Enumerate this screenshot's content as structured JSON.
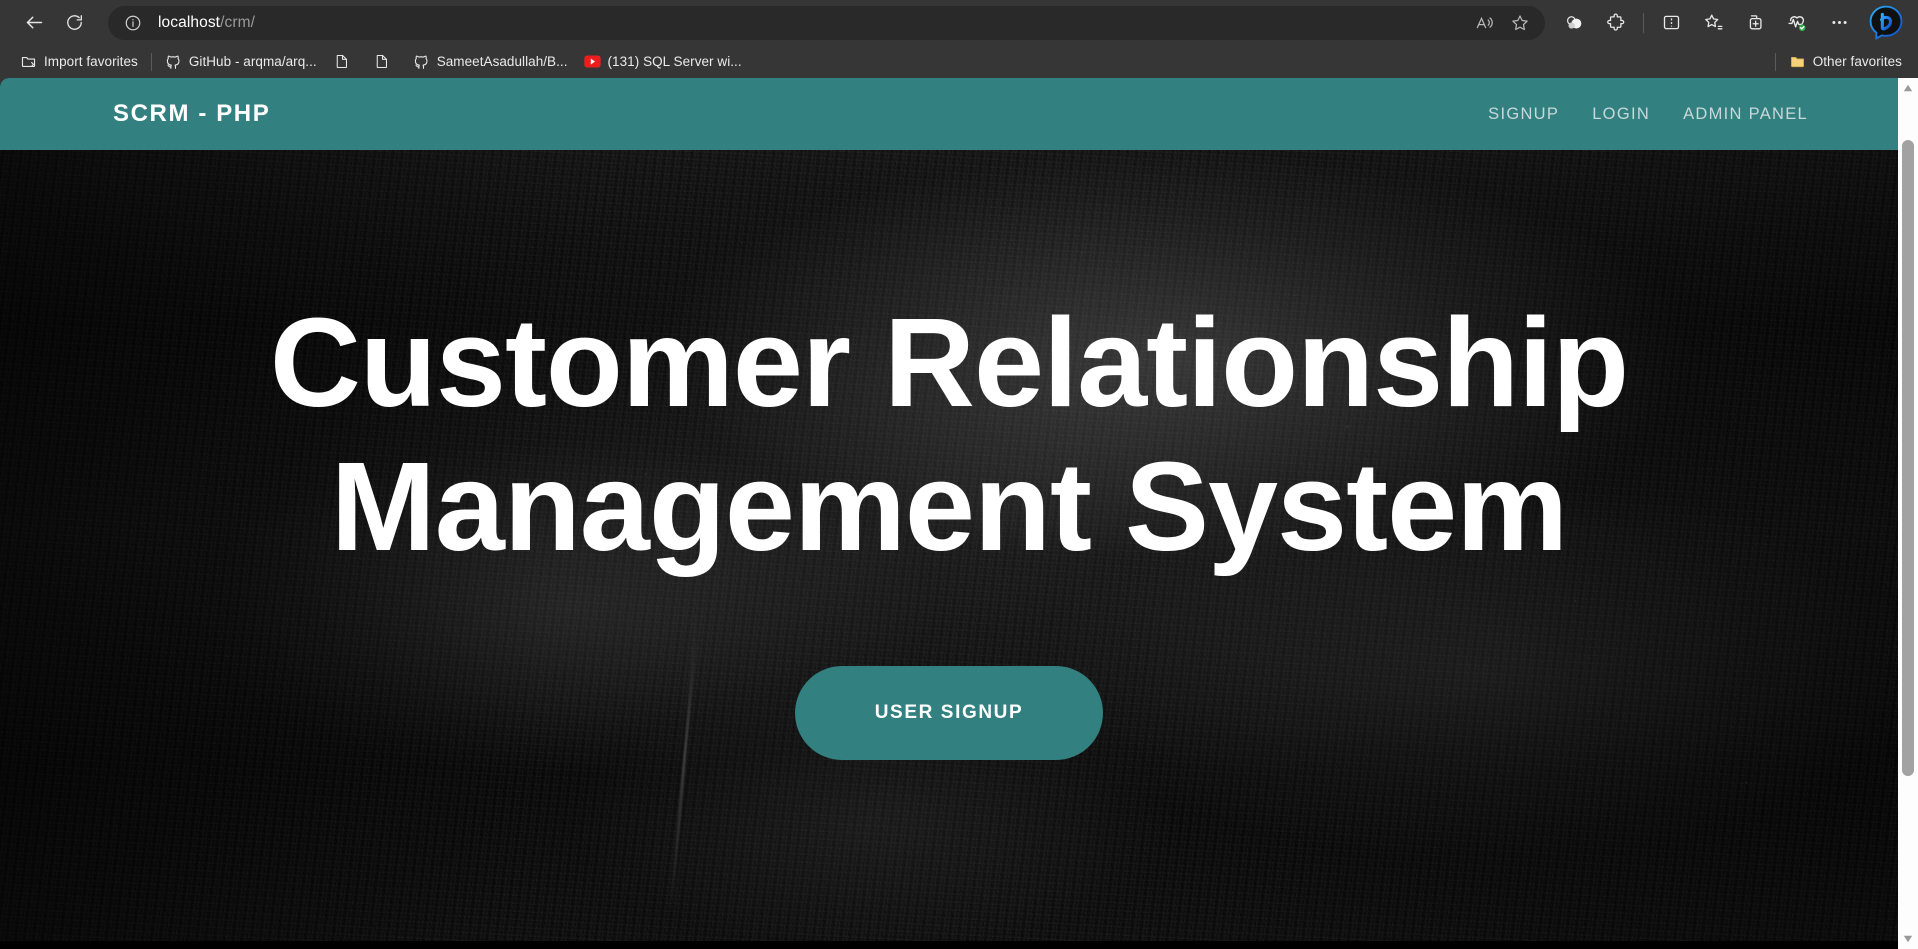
{
  "browser": {
    "back_tooltip": "Back",
    "refresh_tooltip": "Refresh",
    "address": {
      "host": "localhost",
      "path": "/crm/",
      "site_info_icon": "info-circle-icon"
    },
    "omnibox_actions": [
      {
        "name": "read-aloud-icon",
        "label": "Read aloud"
      },
      {
        "name": "favorite-star-icon",
        "label": "Add this page to favorites"
      }
    ],
    "toolbar_actions": [
      {
        "name": "browser-essentials-icon",
        "label": "Browser essentials"
      },
      {
        "name": "extensions-icon",
        "label": "Extensions"
      },
      {
        "name": "split-screen-icon",
        "label": "Split screen"
      },
      {
        "name": "favorites-icon",
        "label": "Favorites"
      },
      {
        "name": "collections-icon",
        "label": "Collections"
      },
      {
        "name": "browser-health-icon",
        "label": "Browser essentials"
      },
      {
        "name": "settings-more-icon",
        "label": "Settings and more"
      },
      {
        "name": "copilot-icon",
        "label": "Copilot"
      }
    ]
  },
  "bookmarks": {
    "items": [
      {
        "label": "Import favorites",
        "icon": "import-favorites-icon"
      },
      {
        "label": "GitHub - arqma/arq...",
        "icon": "github-icon"
      },
      {
        "label": "",
        "icon": "page-icon"
      },
      {
        "label": "",
        "icon": "page-icon"
      },
      {
        "label": "SameetAsadullah/B...",
        "icon": "github-icon"
      },
      {
        "label": "(131) SQL Server wi...",
        "icon": "youtube-icon"
      }
    ],
    "other_favorites": {
      "label": "Other favorites",
      "icon": "folder-icon"
    }
  },
  "site": {
    "brand": "SCRM - PHP",
    "nav": [
      {
        "label": "SIGNUP"
      },
      {
        "label": "LOGIN"
      },
      {
        "label": "ADMIN PANEL"
      }
    ],
    "hero": {
      "title": "Customer Relationship Management System",
      "cta_label": "USER SIGNUP"
    },
    "colors": {
      "teal": "#328080",
      "nav_link": "#c9d8d8",
      "hero_text": "#ffffff",
      "hero_bg": "#0a0a0a"
    }
  },
  "scrollbar": {
    "up_arrow": "scroll-up-arrow-icon",
    "down_arrow": "scroll-down-arrow-icon"
  }
}
